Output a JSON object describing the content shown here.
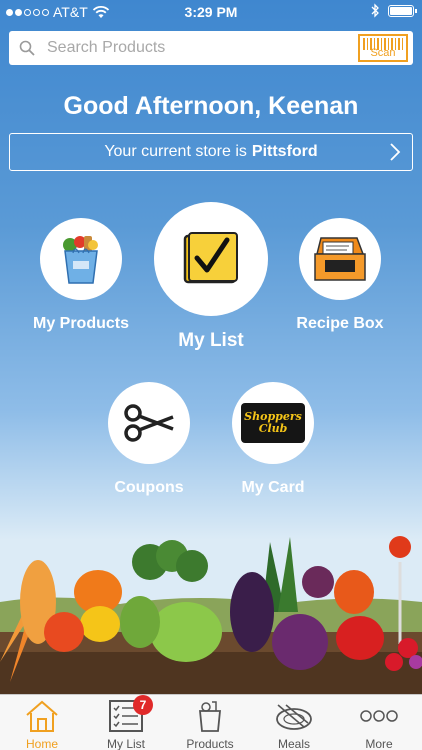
{
  "status": {
    "carrier": "AT&T",
    "time": "3:29 PM"
  },
  "search": {
    "placeholder": "Search Products",
    "scan_label": "Scan"
  },
  "greeting": "Good Afternoon, Keenan",
  "store": {
    "prefix": "Your current store is",
    "name": "Pittsford"
  },
  "tiles": {
    "my_products": "My Products",
    "my_list": "My List",
    "recipe_box": "Recipe Box",
    "coupons": "Coupons",
    "my_card": "My Card",
    "card_logo_line1": "Shoppers",
    "card_logo_line2": "Club"
  },
  "tabs": {
    "home": "Home",
    "my_list": "My List",
    "my_list_badge": "7",
    "products": "Products",
    "meals": "Meals",
    "more": "More"
  },
  "colors": {
    "accent": "#f0a020",
    "badge": "#e02a2a",
    "sky": "#4a8fd2"
  }
}
